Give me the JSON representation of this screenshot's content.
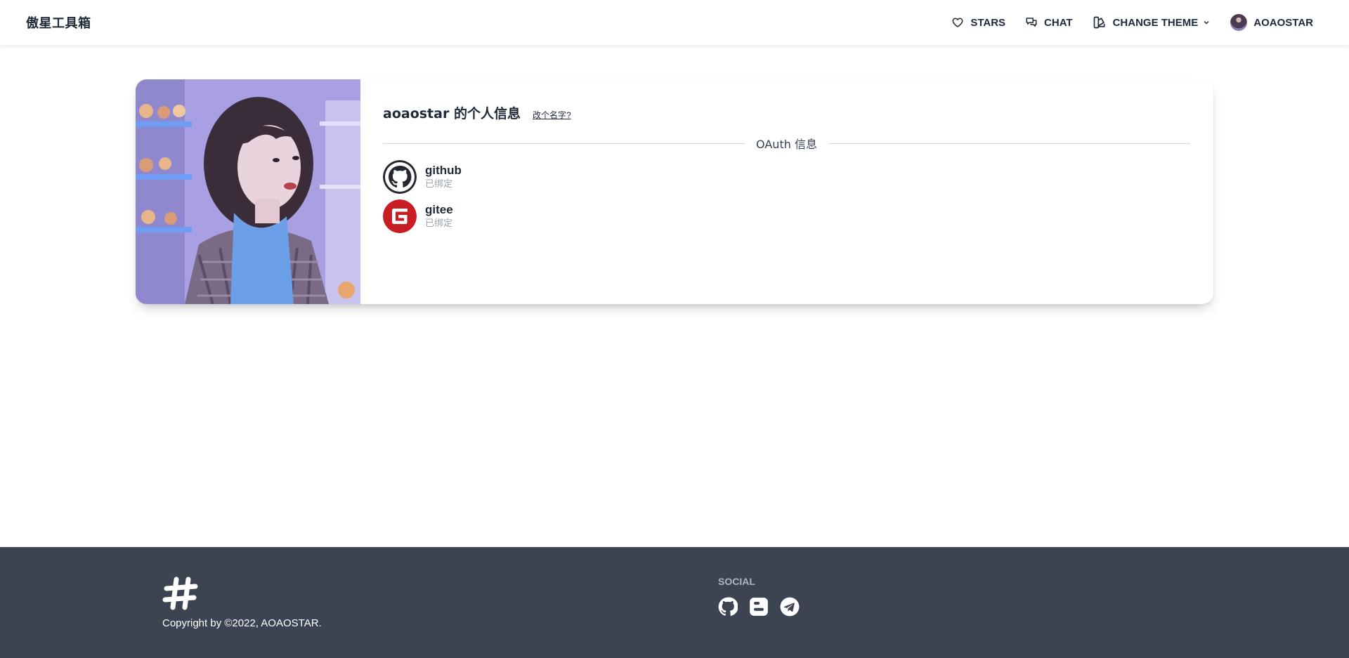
{
  "navbar": {
    "brand": "傲星工具箱",
    "items": [
      {
        "label": "STARS",
        "icon": "heart-icon"
      },
      {
        "label": "CHAT",
        "icon": "chat-icon"
      },
      {
        "label": "CHANGE THEME",
        "icon": "theme-icon"
      },
      {
        "label": "AOAOSTAR",
        "icon": "avatar"
      }
    ]
  },
  "profile": {
    "title": "aoaostar 的个人信息",
    "rename_link": "改个名字?",
    "divider_text": "OAuth 信息",
    "oauth": [
      {
        "name": "github",
        "status": "已绑定",
        "icon": "github-icon",
        "color": "#24292f"
      },
      {
        "name": "gitee",
        "status": "已绑定",
        "icon": "gitee-icon",
        "color": "#c71d23"
      }
    ]
  },
  "footer": {
    "logo": "hash-logo-icon",
    "copyright": "Copyright by ©2022, AOAOSTAR.",
    "social_title": "SOCIAL",
    "social_icons": [
      "github-icon",
      "blogger-icon",
      "telegram-icon"
    ],
    "background": "#3d4451"
  }
}
